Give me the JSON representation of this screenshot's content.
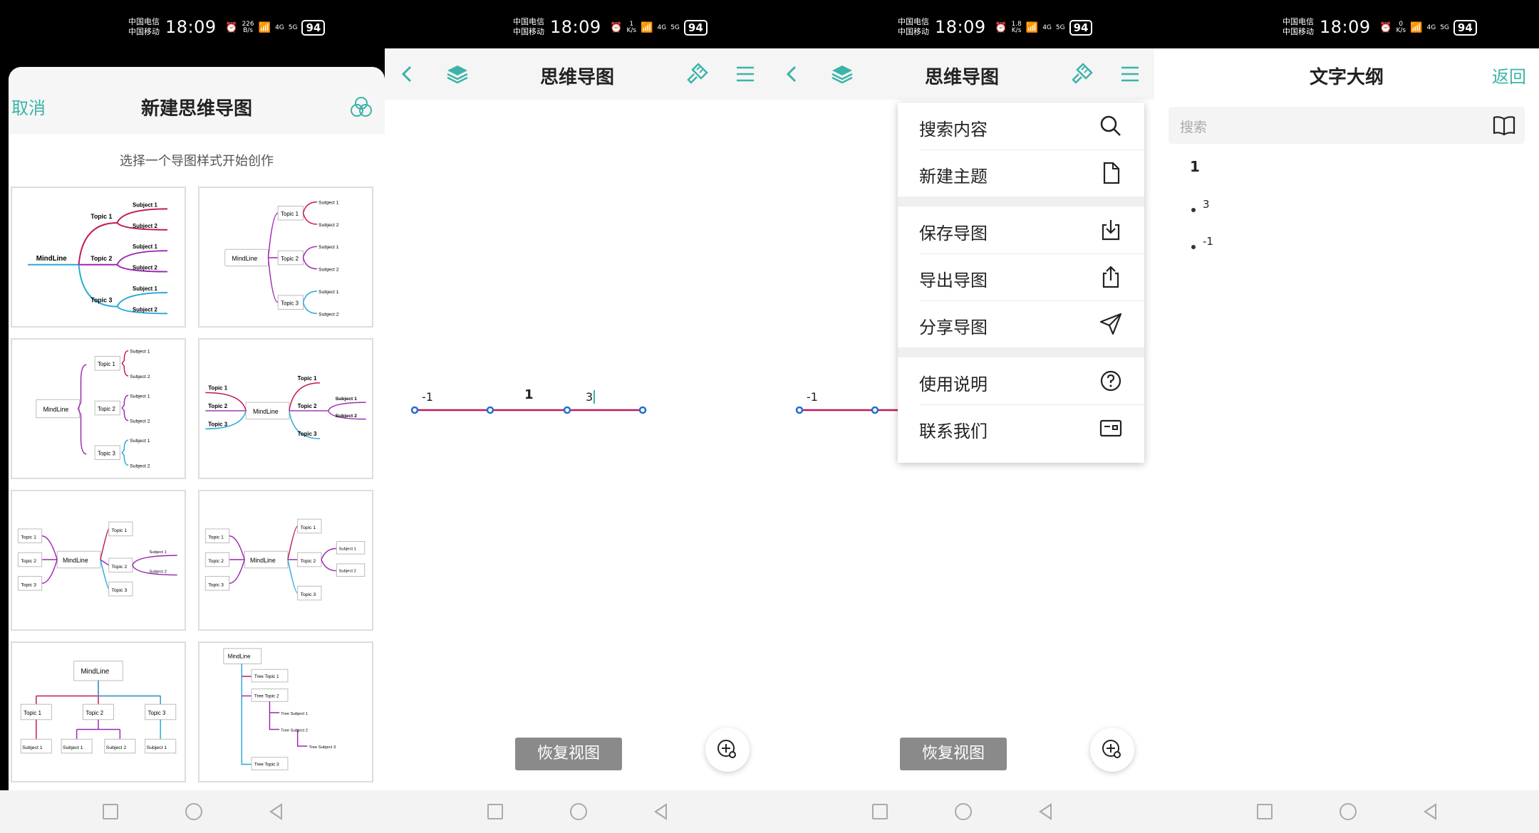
{
  "status": {
    "carrier1": "中国电信",
    "carrier2": "中国移动",
    "time": "18:09",
    "battery": "94",
    "speeds": [
      {
        "value": "226",
        "unit": "B/s"
      },
      {
        "value": "1",
        "unit": "K/s"
      },
      {
        "value": "1.8",
        "unit": "K/s"
      },
      {
        "value": "0",
        "unit": "K/s"
      }
    ],
    "network": [
      "4G",
      "5G"
    ]
  },
  "screen1": {
    "cancel": "取消",
    "title": "新建思维导图",
    "subtitle": "选择一个导图样式开始创作",
    "templates": [
      {
        "center": "MindLine",
        "topics": [
          "Topic 1",
          "Topic 2",
          "Topic 3"
        ],
        "subjects": [
          "Subject 1",
          "Subject 2"
        ]
      },
      {
        "center": "MindLine",
        "topics": [
          "Topic 1",
          "Topic 2",
          "Topic 3"
        ],
        "subjects": [
          "Subject 1",
          "Subject 2"
        ]
      },
      {
        "center": "MindLine",
        "topics": [
          "Topic 1",
          "Topic 2",
          "Topic 3"
        ],
        "subjects": [
          "Subject 1",
          "Subject 2"
        ]
      },
      {
        "center": "MindLine",
        "topics": [
          "Topic 1",
          "Topic 2",
          "Topic 3"
        ],
        "subjects": [
          "Subject 1",
          "Subject 2"
        ]
      },
      {
        "center": "MindLine",
        "topics": [
          "Topic 1",
          "Topic 2",
          "Topic 3"
        ],
        "subjects": [
          "Subject 1",
          "Subject 2"
        ]
      },
      {
        "center": "MindLine",
        "topics": [
          "Topic 1",
          "Topic 2",
          "Topic 3"
        ],
        "subjects": [
          "Subject 1",
          "Subject 2"
        ]
      },
      {
        "center": "MindLine",
        "topics": [
          "Topic 1",
          "Topic 2",
          "Topic 3"
        ],
        "subjects": [
          "Subject 1",
          "Subject 1",
          "Subject 2",
          "Subject 1"
        ]
      },
      {
        "center": "MindLine",
        "topics": [
          "Tree Topic 1",
          "Tree Topic 2",
          "Tree Topic 3"
        ],
        "subjects": [
          "Tree Subject 1",
          "Tree Subject 2",
          "Tree Subject 3"
        ]
      }
    ]
  },
  "screen2": {
    "title": "思维导图",
    "nodes": [
      "-1",
      "1",
      "3"
    ],
    "restore": "恢复视图"
  },
  "screen3": {
    "title": "思维导图",
    "node": "-1",
    "restore": "恢复视图",
    "menu": [
      {
        "label": "搜索内容",
        "icon": "search-icon"
      },
      {
        "label": "新建主题",
        "icon": "file-icon"
      },
      {
        "label": "保存导图",
        "icon": "download-icon"
      },
      {
        "label": "导出导图",
        "icon": "share-out-icon"
      },
      {
        "label": "分享导图",
        "icon": "send-icon"
      },
      {
        "label": "使用说明",
        "icon": "help-icon"
      },
      {
        "label": "联系我们",
        "icon": "contact-card-icon"
      }
    ]
  },
  "screen4": {
    "title": "文字大纲",
    "back": "返回",
    "search_placeholder": "搜索",
    "root": "1",
    "items": [
      "3",
      "-1"
    ]
  },
  "colors": {
    "accent": "#3bb3a8",
    "red": "#c2185b",
    "purple": "#9c27b0",
    "blue": "#29a8d8"
  }
}
